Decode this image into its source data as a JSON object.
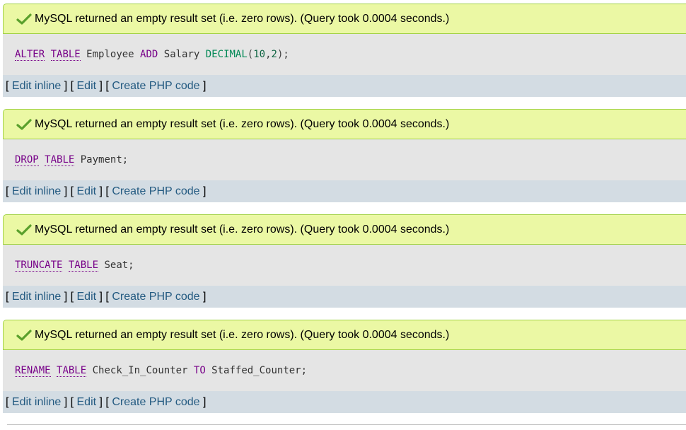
{
  "colors": {
    "success_bg": "#ebf8a4",
    "success_border": "#a2d246",
    "sql_bg": "#e5e5e5",
    "links_bg": "#d3dce3",
    "link": "#235a81",
    "keyword": "#770088",
    "type": "#008855",
    "number": "#116644",
    "check": "#5aa02c"
  },
  "results": [
    {
      "message": "MySQL returned an empty result set (i.e. zero rows). (Query took 0.0004 seconds.)",
      "icon": "check-icon",
      "sql": [
        {
          "t": "ALTER",
          "c": "kw"
        },
        {
          "t": " ",
          "c": "ident"
        },
        {
          "t": "TABLE",
          "c": "kw"
        },
        {
          "t": " Employee ",
          "c": "ident"
        },
        {
          "t": "ADD",
          "c": "kw-plain"
        },
        {
          "t": " Salary ",
          "c": "ident"
        },
        {
          "t": "DECIMAL",
          "c": "type"
        },
        {
          "t": "(",
          "c": "punct"
        },
        {
          "t": "10",
          "c": "num"
        },
        {
          "t": ",",
          "c": "punct"
        },
        {
          "t": "2",
          "c": "num"
        },
        {
          "t": ");",
          "c": "punct"
        }
      ]
    },
    {
      "message": "MySQL returned an empty result set (i.e. zero rows). (Query took 0.0004 seconds.)",
      "icon": "check-icon",
      "sql": [
        {
          "t": "DROP",
          "c": "kw"
        },
        {
          "t": " ",
          "c": "ident"
        },
        {
          "t": "TABLE",
          "c": "kw"
        },
        {
          "t": " Payment;",
          "c": "ident"
        }
      ]
    },
    {
      "message": "MySQL returned an empty result set (i.e. zero rows). (Query took 0.0004 seconds.)",
      "icon": "check-icon",
      "sql": [
        {
          "t": "TRUNCATE",
          "c": "kw"
        },
        {
          "t": " ",
          "c": "ident"
        },
        {
          "t": "TABLE",
          "c": "kw"
        },
        {
          "t": " Seat;",
          "c": "ident"
        }
      ]
    },
    {
      "message": "MySQL returned an empty result set (i.e. zero rows). (Query took 0.0004 seconds.)",
      "icon": "check-icon",
      "sql": [
        {
          "t": "RENAME",
          "c": "kw"
        },
        {
          "t": " ",
          "c": "ident"
        },
        {
          "t": "TABLE",
          "c": "kw"
        },
        {
          "t": " Check_In_Counter ",
          "c": "ident"
        },
        {
          "t": "TO",
          "c": "kw-plain"
        },
        {
          "t": " Staffed_Counter;",
          "c": "ident"
        }
      ]
    }
  ],
  "links": {
    "edit_inline": "Edit inline",
    "edit": "Edit",
    "create_php": "Create PHP code"
  }
}
